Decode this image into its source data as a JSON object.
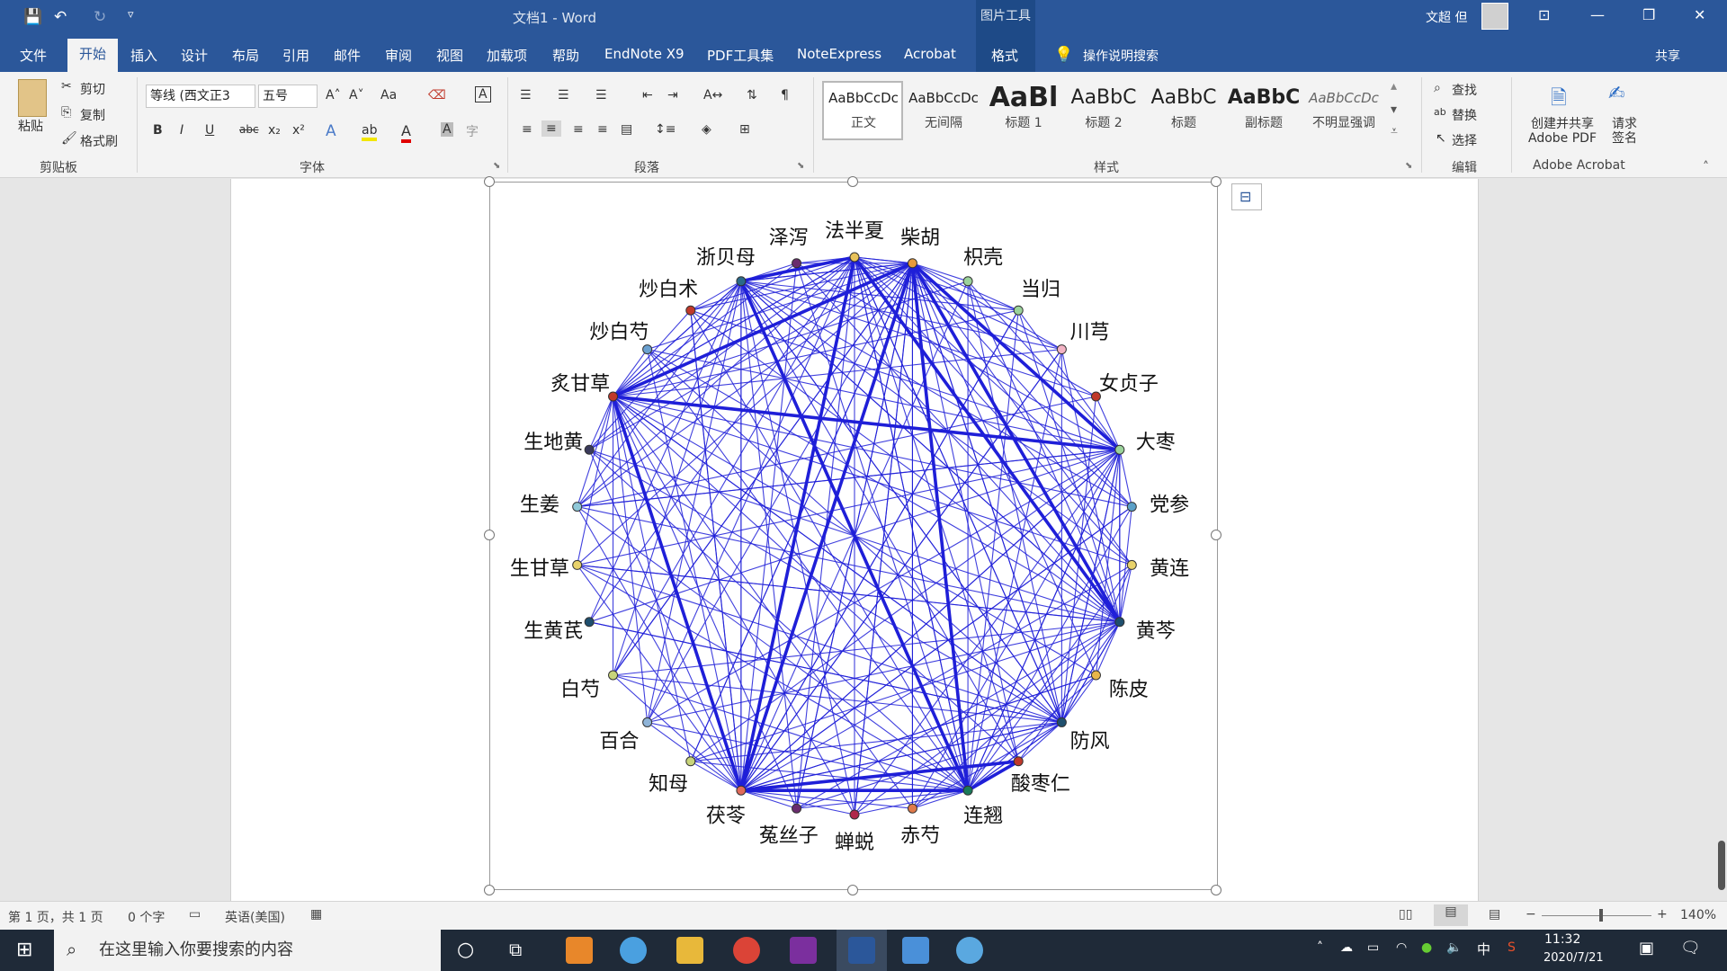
{
  "titlebar": {
    "doc_title": "文档1 - Word",
    "picture_tools": "图片工具",
    "user": "文超 但",
    "save": "💾",
    "undo": "↶",
    "redo": "↻",
    "customize": "▿",
    "ribbon_display": "⊡",
    "minimize": "—",
    "restore": "❐",
    "close": "✕"
  },
  "tabs": [
    "文件",
    "开始",
    "插入",
    "设计",
    "布局",
    "引用",
    "邮件",
    "审阅",
    "视图",
    "加载项",
    "帮助",
    "EndNote X9",
    "PDF工具集",
    "NoteExpress",
    "Acrobat",
    "格式"
  ],
  "tell_me": "操作说明搜索",
  "share": "共享",
  "ribbon": {
    "clipboard": {
      "paste": "粘贴",
      "cut": "剪切",
      "copy": "复制",
      "format_painter": "格式刷",
      "label": "剪贴板"
    },
    "font": {
      "font_name": "等线 (西文正3",
      "font_size": "五号",
      "label": "字体",
      "grow": "A˄",
      "shrink": "A˅",
      "case": "Aa",
      "bold": "B",
      "italic": "I",
      "underline": "U",
      "strike": "abc",
      "sub": "x₂",
      "sup": "x²",
      "effect": "A",
      "highlight": "ab",
      "color": "A",
      "shade": "A",
      "enclose": "字"
    },
    "paragraph": {
      "label": "段落"
    },
    "styles": {
      "label": "样式",
      "items": [
        {
          "sample": "AaBbCcDc",
          "name": "正文"
        },
        {
          "sample": "AaBbCcDc",
          "name": "无间隔"
        },
        {
          "sample": "AaBl",
          "name": "标题 1"
        },
        {
          "sample": "AaBbC",
          "name": "标题 2"
        },
        {
          "sample": "AaBbC",
          "name": "标题"
        },
        {
          "sample": "AaBbC",
          "name": "副标题"
        },
        {
          "sample": "AaBbCcDc",
          "name": "不明显强调"
        }
      ]
    },
    "editing": {
      "find": "查找",
      "replace": "替换",
      "select": "选择",
      "label": "编辑"
    },
    "acrobat": {
      "create_share": "创建并共享 Adobe PDF",
      "request_sign": "请求 签名",
      "label": "Adobe Acrobat"
    }
  },
  "network": {
    "nodes": [
      "泽泻",
      "法半夏",
      "柴胡",
      "枳壳",
      "当归",
      "川芎",
      "女贞子",
      "大枣",
      "党参",
      "黄连",
      "黄芩",
      "陈皮",
      "防风",
      "酸枣仁",
      "连翘",
      "赤芍",
      "蝉蜕",
      "菟丝子",
      "茯苓",
      "知母",
      "百合",
      "白芍",
      "生黄芪",
      "生甘草",
      "生姜",
      "生地黄",
      "炙甘草",
      "炒白芍",
      "炒白术",
      "浙贝母"
    ],
    "colors": [
      "#6a2c6e",
      "#e8c25a",
      "#e89a3c",
      "#9bd39b",
      "#9bd39b",
      "#f3b3c4",
      "#c0392b",
      "#9bd39b",
      "#5aa0c8",
      "#e8d26a",
      "#1f4f6e",
      "#e8b64a",
      "#1f4f6e",
      "#c0392b",
      "#1a7a5a",
      "#e07a4a",
      "#b0284a",
      "#6a2c6e",
      "#e06a5a",
      "#c8d47a",
      "#8fb4d8",
      "#c8d47a",
      "#1f4f6e",
      "#e8d26a",
      "#8fc8d8",
      "#3a3a5a",
      "#c0392b",
      "#6aa0d0",
      "#c0392b",
      "#2a6a8a"
    ],
    "edge_color": "#1f1fd8"
  },
  "status": {
    "page": "第 1 页，共 1 页",
    "words": "0 个字",
    "lang": "英语(美国)",
    "zoom": "140%",
    "minus": "−",
    "plus": "+"
  },
  "taskbar": {
    "search": "在这里输入你要搜索的内容",
    "time": "11:32",
    "date": "2020/7/21",
    "ime": "中"
  }
}
